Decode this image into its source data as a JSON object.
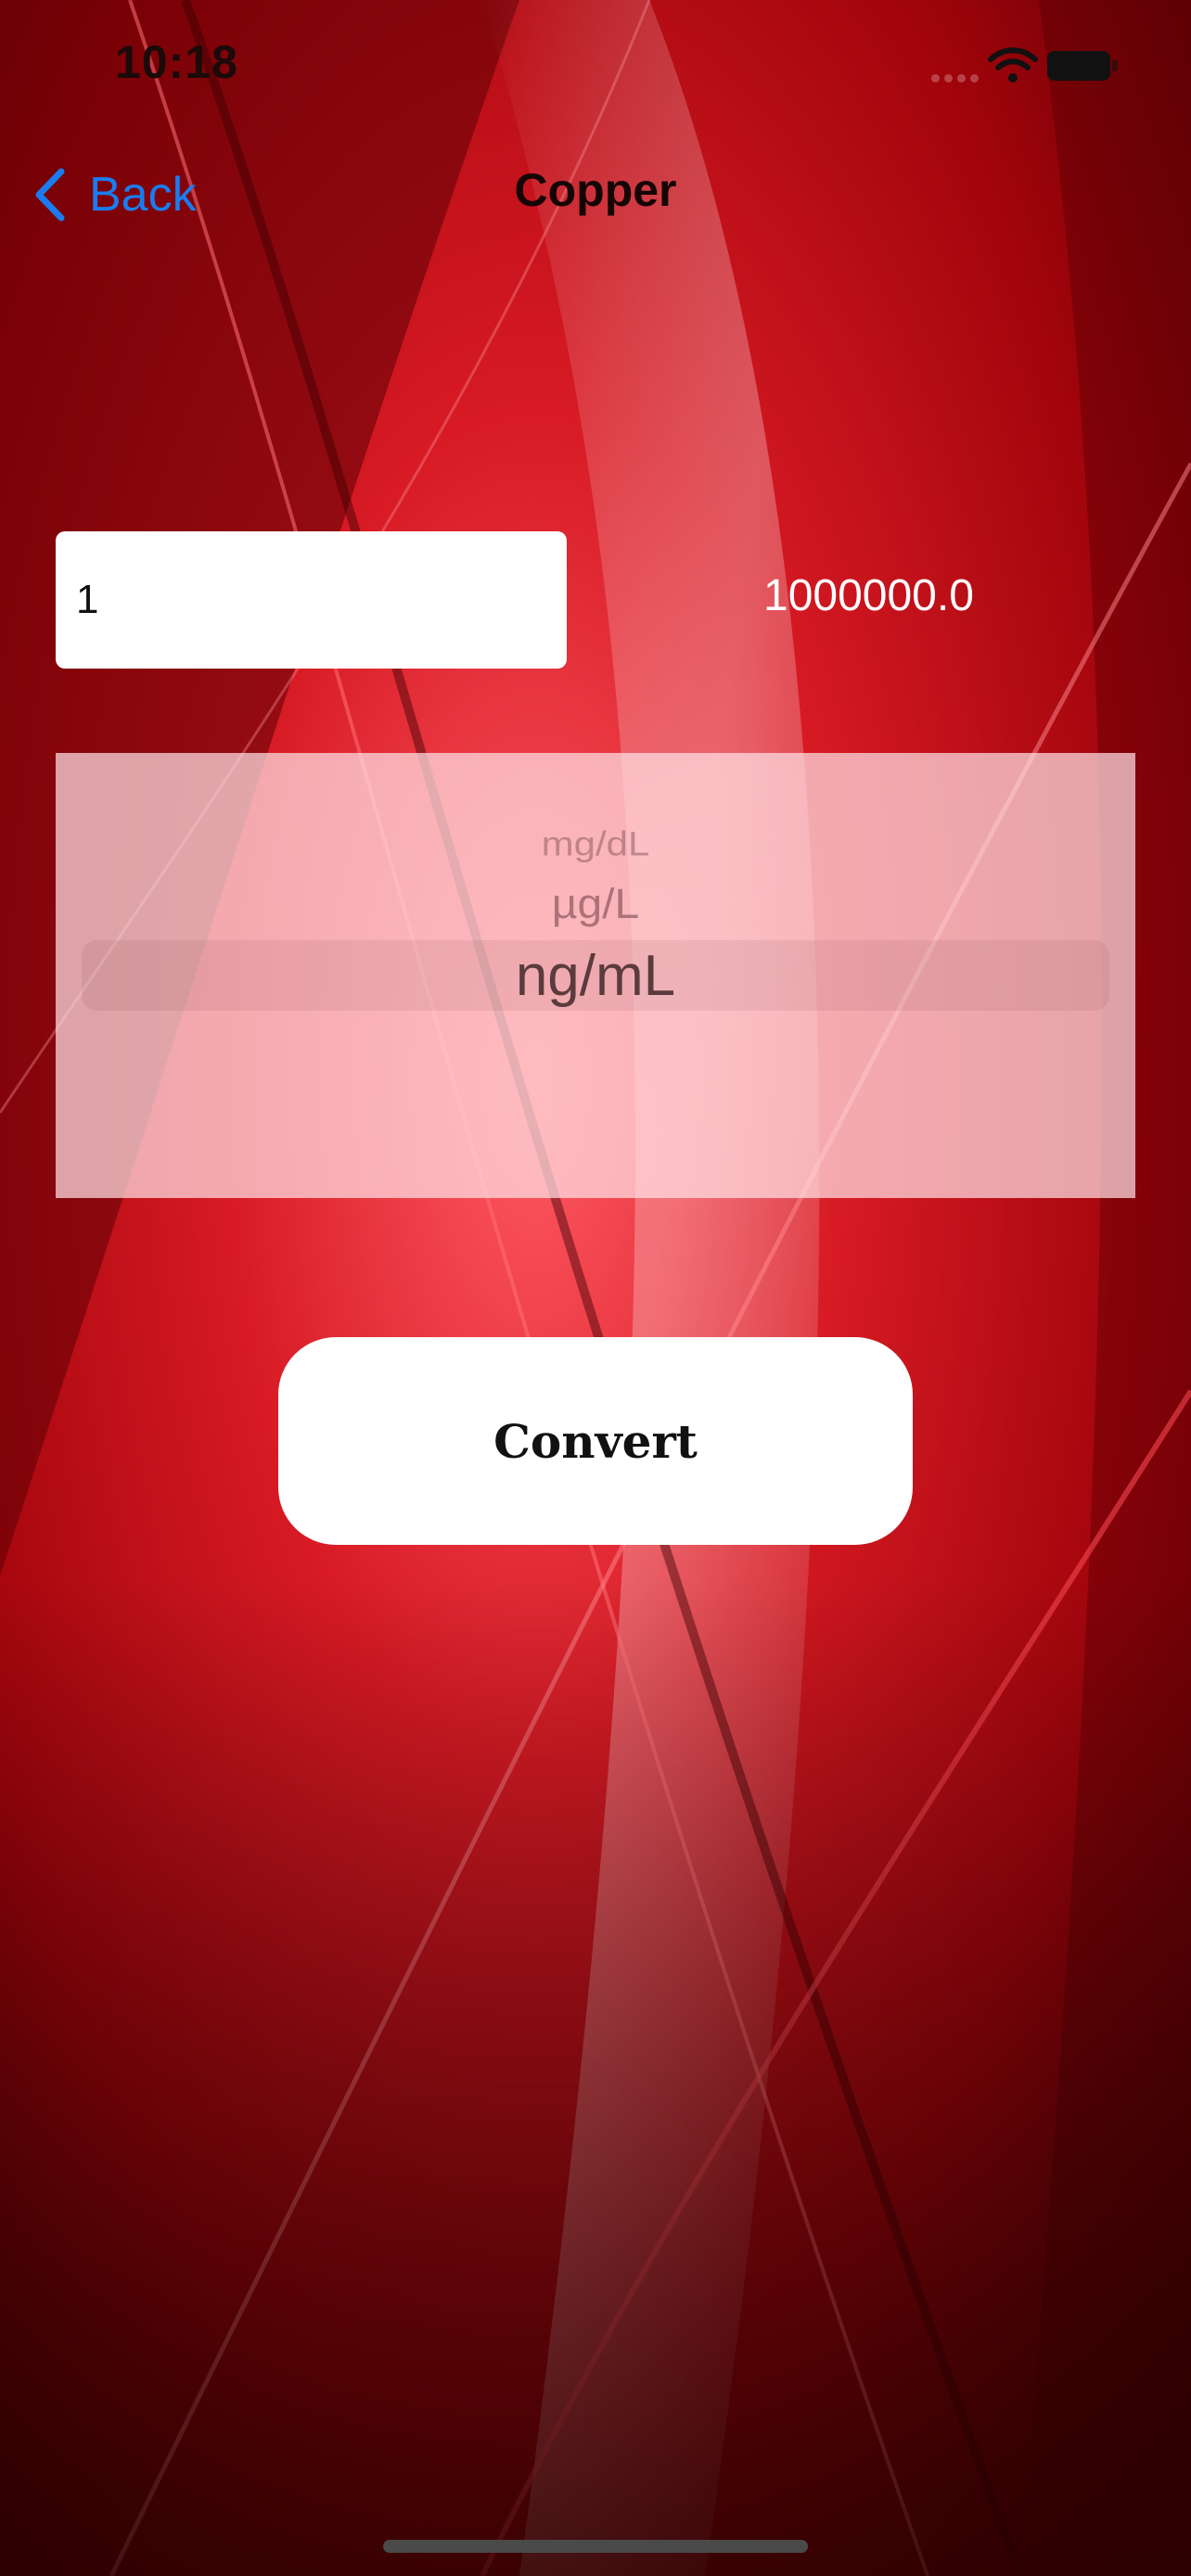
{
  "status_bar": {
    "time": "10:18",
    "icons": [
      "signal-icon",
      "wifi-icon",
      "battery-icon"
    ]
  },
  "nav": {
    "back_label": "Back",
    "title": "Copper",
    "back_icon": "chevron-left-icon"
  },
  "converter": {
    "input_value": "1",
    "result": "1000000.0",
    "unit_options": [
      "mg/dL",
      "µg/L",
      "ng/mL"
    ],
    "selected_unit": "ng/mL",
    "convert_label": "Convert"
  },
  "colors": {
    "accent": "#1a7cf0",
    "background": "#b3030a",
    "button": "#ffffff"
  }
}
